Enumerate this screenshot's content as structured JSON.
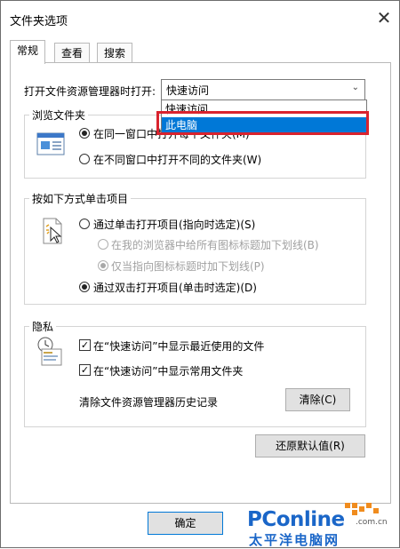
{
  "window": {
    "title": "文件夹选项",
    "close_glyph": "✕"
  },
  "tabs": [
    {
      "label": "常规"
    },
    {
      "label": "查看"
    },
    {
      "label": "搜索"
    }
  ],
  "open_in": {
    "label": "打开文件资源管理器时打开:",
    "selected": "快速访问",
    "options": [
      "快速访问",
      "此电脑"
    ],
    "highlighted": "此电脑"
  },
  "browse": {
    "title": "浏览文件夹",
    "opt_same": "在同一窗口中打开每个文件夹(M)",
    "opt_new": "在不同窗口中打开不同的文件夹(W)"
  },
  "click": {
    "title": "按如下方式单击项目",
    "opt_single": "通过单击打开项目(指向时选定)(S)",
    "sub_browser": "在我的浏览器中给所有图标标题加下划线(B)",
    "sub_point": "仅当指向图标标题时加下划线(P)",
    "opt_double": "通过双击打开项目(单击时选定)(D)"
  },
  "privacy": {
    "title": "隐私",
    "recent_files": "在“快速访问”中显示最近使用的文件",
    "frequent_folders": "在“快速访问”中显示常用文件夹",
    "clear_label": "清除文件资源管理器历史记录",
    "clear_button": "清除(C)"
  },
  "restore_button": "还原默认值(R)",
  "ok_button": "确定",
  "watermark": {
    "brand": "PConline",
    "domain": ".com.cn",
    "cn": "太平洋电脑网"
  },
  "colors": {
    "highlight": "#0078d7",
    "callout": "#d9232e",
    "brand_blue": "#1a66c8",
    "brand_orange": "#f08c1e"
  }
}
